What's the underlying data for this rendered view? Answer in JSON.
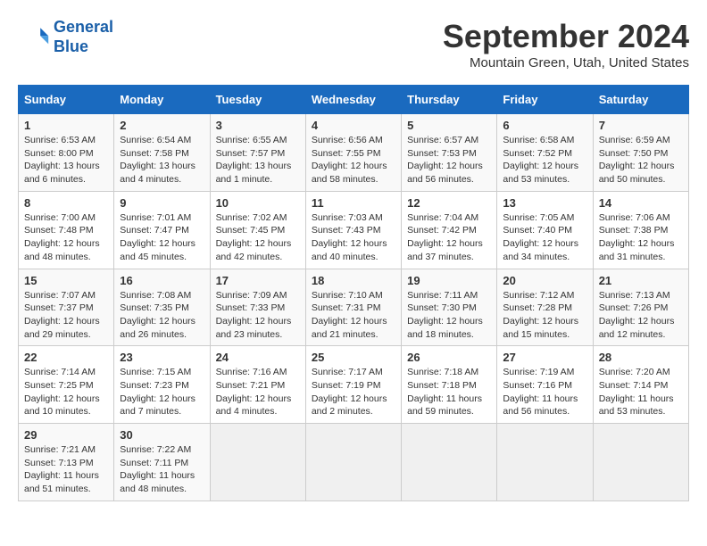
{
  "header": {
    "logo_line1": "General",
    "logo_line2": "Blue",
    "month": "September 2024",
    "location": "Mountain Green, Utah, United States"
  },
  "weekdays": [
    "Sunday",
    "Monday",
    "Tuesday",
    "Wednesday",
    "Thursday",
    "Friday",
    "Saturday"
  ],
  "weeks": [
    [
      {
        "day": "1",
        "info": "Sunrise: 6:53 AM\nSunset: 8:00 PM\nDaylight: 13 hours and 6 minutes."
      },
      {
        "day": "2",
        "info": "Sunrise: 6:54 AM\nSunset: 7:58 PM\nDaylight: 13 hours and 4 minutes."
      },
      {
        "day": "3",
        "info": "Sunrise: 6:55 AM\nSunset: 7:57 PM\nDaylight: 13 hours and 1 minute."
      },
      {
        "day": "4",
        "info": "Sunrise: 6:56 AM\nSunset: 7:55 PM\nDaylight: 12 hours and 58 minutes."
      },
      {
        "day": "5",
        "info": "Sunrise: 6:57 AM\nSunset: 7:53 PM\nDaylight: 12 hours and 56 minutes."
      },
      {
        "day": "6",
        "info": "Sunrise: 6:58 AM\nSunset: 7:52 PM\nDaylight: 12 hours and 53 minutes."
      },
      {
        "day": "7",
        "info": "Sunrise: 6:59 AM\nSunset: 7:50 PM\nDaylight: 12 hours and 50 minutes."
      }
    ],
    [
      {
        "day": "8",
        "info": "Sunrise: 7:00 AM\nSunset: 7:48 PM\nDaylight: 12 hours and 48 minutes."
      },
      {
        "day": "9",
        "info": "Sunrise: 7:01 AM\nSunset: 7:47 PM\nDaylight: 12 hours and 45 minutes."
      },
      {
        "day": "10",
        "info": "Sunrise: 7:02 AM\nSunset: 7:45 PM\nDaylight: 12 hours and 42 minutes."
      },
      {
        "day": "11",
        "info": "Sunrise: 7:03 AM\nSunset: 7:43 PM\nDaylight: 12 hours and 40 minutes."
      },
      {
        "day": "12",
        "info": "Sunrise: 7:04 AM\nSunset: 7:42 PM\nDaylight: 12 hours and 37 minutes."
      },
      {
        "day": "13",
        "info": "Sunrise: 7:05 AM\nSunset: 7:40 PM\nDaylight: 12 hours and 34 minutes."
      },
      {
        "day": "14",
        "info": "Sunrise: 7:06 AM\nSunset: 7:38 PM\nDaylight: 12 hours and 31 minutes."
      }
    ],
    [
      {
        "day": "15",
        "info": "Sunrise: 7:07 AM\nSunset: 7:37 PM\nDaylight: 12 hours and 29 minutes."
      },
      {
        "day": "16",
        "info": "Sunrise: 7:08 AM\nSunset: 7:35 PM\nDaylight: 12 hours and 26 minutes."
      },
      {
        "day": "17",
        "info": "Sunrise: 7:09 AM\nSunset: 7:33 PM\nDaylight: 12 hours and 23 minutes."
      },
      {
        "day": "18",
        "info": "Sunrise: 7:10 AM\nSunset: 7:31 PM\nDaylight: 12 hours and 21 minutes."
      },
      {
        "day": "19",
        "info": "Sunrise: 7:11 AM\nSunset: 7:30 PM\nDaylight: 12 hours and 18 minutes."
      },
      {
        "day": "20",
        "info": "Sunrise: 7:12 AM\nSunset: 7:28 PM\nDaylight: 12 hours and 15 minutes."
      },
      {
        "day": "21",
        "info": "Sunrise: 7:13 AM\nSunset: 7:26 PM\nDaylight: 12 hours and 12 minutes."
      }
    ],
    [
      {
        "day": "22",
        "info": "Sunrise: 7:14 AM\nSunset: 7:25 PM\nDaylight: 12 hours and 10 minutes."
      },
      {
        "day": "23",
        "info": "Sunrise: 7:15 AM\nSunset: 7:23 PM\nDaylight: 12 hours and 7 minutes."
      },
      {
        "day": "24",
        "info": "Sunrise: 7:16 AM\nSunset: 7:21 PM\nDaylight: 12 hours and 4 minutes."
      },
      {
        "day": "25",
        "info": "Sunrise: 7:17 AM\nSunset: 7:19 PM\nDaylight: 12 hours and 2 minutes."
      },
      {
        "day": "26",
        "info": "Sunrise: 7:18 AM\nSunset: 7:18 PM\nDaylight: 11 hours and 59 minutes."
      },
      {
        "day": "27",
        "info": "Sunrise: 7:19 AM\nSunset: 7:16 PM\nDaylight: 11 hours and 56 minutes."
      },
      {
        "day": "28",
        "info": "Sunrise: 7:20 AM\nSunset: 7:14 PM\nDaylight: 11 hours and 53 minutes."
      }
    ],
    [
      {
        "day": "29",
        "info": "Sunrise: 7:21 AM\nSunset: 7:13 PM\nDaylight: 11 hours and 51 minutes."
      },
      {
        "day": "30",
        "info": "Sunrise: 7:22 AM\nSunset: 7:11 PM\nDaylight: 11 hours and 48 minutes."
      },
      {
        "day": "",
        "info": ""
      },
      {
        "day": "",
        "info": ""
      },
      {
        "day": "",
        "info": ""
      },
      {
        "day": "",
        "info": ""
      },
      {
        "day": "",
        "info": ""
      }
    ]
  ]
}
